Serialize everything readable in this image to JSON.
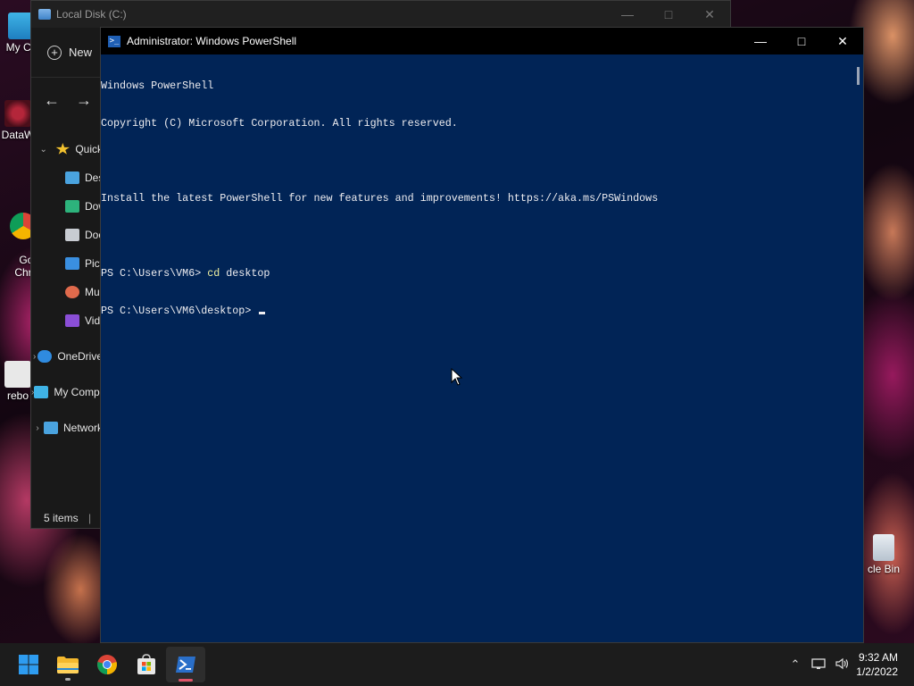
{
  "desktop": {
    "icons": [
      {
        "label": "My Co"
      },
      {
        "label": "DataW"
      },
      {
        "label": "Go\nChr"
      },
      {
        "label": "rebo"
      },
      {
        "label": "cle Bin"
      }
    ]
  },
  "explorer": {
    "title": "Local Disk (C:)",
    "new_label": "New",
    "sidebar": [
      {
        "label": "Quick",
        "chevron": "⌄"
      },
      {
        "label": "Desktop"
      },
      {
        "label": "Downloads"
      },
      {
        "label": "Documents"
      },
      {
        "label": "Pictures"
      },
      {
        "label": "Music"
      },
      {
        "label": "Videos"
      },
      {
        "label": "OneDrive",
        "chevron": "›"
      },
      {
        "label": "My Computer",
        "chevron": "›"
      },
      {
        "label": "Network",
        "chevron": "›"
      }
    ],
    "status": "5 items"
  },
  "powershell": {
    "title": "Administrator: Windows PowerShell",
    "lines": [
      "Windows PowerShell",
      "Copyright (C) Microsoft Corporation. All rights reserved.",
      "",
      "Install the latest PowerShell for new features and improvements! https://aka.ms/PSWindows",
      ""
    ],
    "prompt1": "PS C:\\Users\\VM6> ",
    "cmd1_name": "cd",
    "cmd1_arg": " desktop",
    "prompt2": "PS C:\\Users\\VM6\\desktop> "
  },
  "taskbar": {
    "apps": [
      "start",
      "file-explorer",
      "chrome",
      "store",
      "powershell"
    ],
    "time": "9:32 AM",
    "date": "1/2/2022"
  },
  "colors": {
    "console_bg": "#012456",
    "console_fg": "#eeedf0",
    "command_yellow": "#f1f1a0"
  }
}
